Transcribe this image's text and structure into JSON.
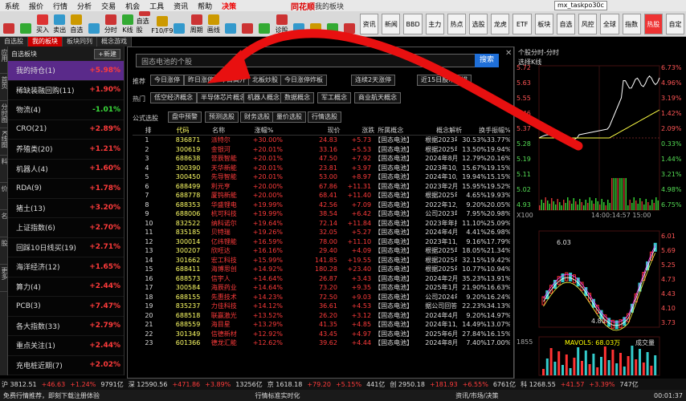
{
  "menu": [
    "系统",
    "报价",
    "行情",
    "分析",
    "交易",
    "机会",
    "工具",
    "资讯",
    "帮助",
    "决策"
  ],
  "logo": "同花顺",
  "window_title": "我的板块",
  "account": "mx_taskpo30c",
  "toolbar_left": [
    "",
    "",
    "买入",
    "卖出",
    "自选",
    "",
    "分时",
    "K线",
    "自选股",
    "F10/F9",
    "",
    "周期",
    "画线",
    "",
    "",
    "",
    "诊股",
    "",
    "",
    "",
    ""
  ],
  "toolbar_right": [
    "资讯",
    "新闻",
    "BBD",
    "主力",
    "热点",
    "选股",
    "龙虎",
    "ETF",
    "板块",
    "自选",
    "风控",
    "全球",
    "指数",
    "热股",
    "自定"
  ],
  "tabs": [
    "自选股",
    "我的板块",
    "板块同列",
    "概念游戏"
  ],
  "vtabs": [
    "应用",
    "首页",
    "分时图",
    "K线图",
    "个股资料",
    "自选报价",
    "综合排名",
    "牛叉诊股",
    "更多"
  ],
  "sidebar": {
    "head": "自选板块",
    "btn": "+新建",
    "items": [
      {
        "name": "我的持仓(1)",
        "val": "+5.98%",
        "dir": "up",
        "act": true
      },
      {
        "name": "稀缺装融回购(11)",
        "val": "+1.90%",
        "dir": "up"
      },
      {
        "name": "物流(4)",
        "val": "-1.01%",
        "dir": "down"
      },
      {
        "name": "CRO(21)",
        "val": "+2.89%",
        "dir": "up"
      },
      {
        "name": "养殖类(20)",
        "val": "+1.21%",
        "dir": "up"
      },
      {
        "name": "机器人(4)",
        "val": "+1.60%",
        "dir": "up"
      },
      {
        "name": "RDA(9)",
        "val": "+1.78%",
        "dir": "up"
      },
      {
        "name": "猪土(13)",
        "val": "+3.20%",
        "dir": "up"
      },
      {
        "name": "上证指数(6)",
        "val": "+2.70%",
        "dir": "up"
      },
      {
        "name": "回踩10日线买(19)",
        "val": "+2.71%",
        "dir": "up"
      },
      {
        "name": "海洋经济(12)",
        "val": "+1.65%",
        "dir": "up"
      },
      {
        "name": "算力(4)",
        "val": "+2.44%",
        "dir": "up"
      },
      {
        "name": "PCB(3)",
        "val": "+7.47%",
        "dir": "up"
      },
      {
        "name": "各大指数(33)",
        "val": "+2.79%",
        "dir": "up"
      },
      {
        "name": "重点关注(1)",
        "val": "+2.44%",
        "dir": "up"
      },
      {
        "name": "充电桩近期(7)",
        "val": "+2.02%",
        "dir": "up"
      }
    ]
  },
  "search": {
    "placeholder": "固态电池的个股",
    "btn": "搜索"
  },
  "rows": {
    "tuijian": "推荐",
    "redian": "热门",
    "gongshi": "公式选股",
    "r1": [
      "今日涨停",
      "昨日涨停，今日高开",
      "北板炒股",
      "今日涨停炸板",
      "连续2天涨停",
      "近15日股市榜排"
    ],
    "r2": [
      "低空经济概念",
      "半导体芯片概念",
      "机器人概念",
      "数据概念",
      "军工概念",
      "商业航天概念"
    ],
    "r3": [
      "盘中预警",
      "预测选股",
      "财务选股",
      "量价选股",
      "行情选股"
    ]
  },
  "table_head": [
    "",
    "排",
    "代码",
    "名称",
    "涨幅%",
    "现价",
    "涨跌",
    "所属概念",
    "概念解析",
    "换手",
    "振幅%"
  ],
  "table_rows": [
    [
      "1",
      "836871",
      "派特尔",
      "+30.00%",
      "24.83",
      "+5.73",
      "【固态电池】",
      "根据2023年…",
      "30.53%",
      "33.77%"
    ],
    [
      "2",
      "300619",
      "金银河",
      "+20.01%",
      "33.16",
      "+5.53",
      "【固态电池】",
      "根据2025年…",
      "13.50%",
      "19.94%"
    ],
    [
      "3",
      "688638",
      "誉辰智能",
      "+20.01%",
      "47.50",
      "+7.92",
      "【固态电池】",
      "2024年8月2…",
      "12.79%",
      "20.16%"
    ],
    [
      "4",
      "300390",
      "天华新能",
      "+20.01%",
      "23.81",
      "+3.97",
      "【固态电池】",
      "2023年10月…",
      "15.67%",
      "19.15%"
    ],
    [
      "5",
      "300450",
      "先导智能",
      "+20.01%",
      "53.00",
      "+8.97",
      "【固态电池】",
      "2024年10月…",
      "19.94%",
      "15.15%"
    ],
    [
      "6",
      "688499",
      "利元亨",
      "+20.00%",
      "67.86",
      "+11.31",
      "【固态电池】",
      "2023年2月1…",
      "15.95%",
      "19.52%"
    ],
    [
      "7",
      "688778",
      "厦钨新能",
      "+20.00%",
      "68.41",
      "+11.40",
      "【固态电池】",
      "根据2025年…",
      "4.65%",
      "19.93%"
    ],
    [
      "8",
      "688353",
      "华盛锂电",
      "+19.99%",
      "42.56",
      "+7.09",
      "【固态电池】",
      "2022年12月…",
      "9.20%",
      "20.05%"
    ],
    [
      "9",
      "688006",
      "杭可科技",
      "+19.99%",
      "38.54",
      "+6.42",
      "【固态电池】",
      "公司2023年…",
      "7.95%",
      "20.98%"
    ],
    [
      "10",
      "832522",
      "纳科诺尔",
      "+19.64%",
      "72.14",
      "+11.84",
      "【固态电池】",
      "2023年年报…",
      "11.10%",
      "25.09%"
    ],
    [
      "11",
      "835185",
      "贝特瑞",
      "+19.26%",
      "32.05",
      "+5.27",
      "【固态电池】",
      "2024年4月2…",
      "4.41%",
      "26.98%"
    ],
    [
      "12",
      "300014",
      "亿纬锂能",
      "+16.59%",
      "78.00",
      "+11.10",
      "【固态电池】",
      "2023年11月…",
      "9.16%",
      "17.79%"
    ],
    [
      "13",
      "300207",
      "欣旺达",
      "+16.16%",
      "29.40",
      "+4.09",
      "【固态电池】",
      "根据2025年…",
      "18.05%",
      "21.34%"
    ],
    [
      "14",
      "301662",
      "宏工科技",
      "+15.99%",
      "141.85",
      "+19.55",
      "【固态电池】",
      "根据2025年…",
      "32.15%",
      "19.42%"
    ],
    [
      "15",
      "688411",
      "海博思创",
      "+14.92%",
      "180.28",
      "+23.40",
      "【固态电池】",
      "根据2025年…",
      "10.77%",
      "10.94%"
    ],
    [
      "16",
      "688573",
      "信宇人",
      "+14.64%",
      "26.87",
      "+3.43",
      "【固态电池】",
      "2024年2月2…",
      "35.23%",
      "13.91%"
    ],
    [
      "17",
      "300584",
      "海辰药业",
      "+14.64%",
      "73.20",
      "+9.35",
      "【固态电池】",
      "2025年1月1…",
      "21.90%",
      "16.63%"
    ],
    [
      "18",
      "688155",
      "先惠技术",
      "+14.23%",
      "72.50",
      "+9.03",
      "【固态电池】",
      "公司2024年…",
      "9.20%",
      "16.24%"
    ],
    [
      "19",
      "835237",
      "力佳科技",
      "+14.12%",
      "36.61",
      "+4.53",
      "【固态电池】",
      "据公司回答…",
      "22.23%",
      "34.13%"
    ],
    [
      "20",
      "688518",
      "联赢激光",
      "+13.52%",
      "26.20",
      "+3.12",
      "【固态电池】",
      "2024年4月2…",
      "9.20%",
      "14.97%"
    ],
    [
      "21",
      "688559",
      "海目星",
      "+13.29%",
      "41.35",
      "+4.85",
      "【固态电池】",
      "2024年11月…",
      "14.49%",
      "13.07%"
    ],
    [
      "22",
      "301349",
      "信德新材",
      "+12.92%",
      "43.45",
      "+4.97",
      "【固态电池】",
      "2025年6月1…",
      "27.84%",
      "16.15%"
    ],
    [
      "23",
      "601366",
      "德龙汇能",
      "+12.62%",
      "39.62",
      "+4.44",
      "【固态电池】",
      "2024年8月2…",
      "7.40%",
      "17.00%"
    ]
  ],
  "chart": {
    "top_title": "个股分时-分时",
    "kline_title": "选择K线",
    "price_labels": [
      "5.72",
      "5.63",
      "5.55",
      "5.46",
      "5.37",
      "5.28",
      "5.19",
      "5.11",
      "5.02",
      "4.93"
    ],
    "pct_labels": [
      "6.73%",
      "4.96%",
      "3.19%",
      "1.42%",
      "2.09%",
      "0.33%",
      "1.44%",
      "3.21%",
      "4.98%",
      "6.75%"
    ],
    "vol_label": "X100",
    "vol_val": "1567",
    "time_end": "14:00:14:57 15:00",
    "k_high": "6.03",
    "k_low": "4.80",
    "k_labels": [
      "6.01",
      "5.69",
      "5.25",
      "4.73",
      "4.43",
      "4.10",
      "3.73"
    ],
    "macd": "MAVOL5: 68.03万",
    "vol_k": "成交量",
    "vol_k2": "1855"
  },
  "statusbar": [
    "沪 3812.51",
    "+46.63",
    "+1.24%",
    "9791亿",
    "深 12590.56",
    "+471.86",
    "+3.89%",
    "13256亿",
    "京 1618.18",
    "+79.20",
    "+5.15%",
    "441亿",
    "创 2950.18",
    "+181.93",
    "+6.55%",
    "6761亿",
    "科 1268.55",
    "+41.57",
    "+3.39%",
    "747亿"
  ],
  "bottom": {
    "left": "免费行情推荐，即刻下载注册体验",
    "mid": "行情标准实时化",
    "right": "资讯/市场/决策",
    "time": "00:01:37"
  }
}
